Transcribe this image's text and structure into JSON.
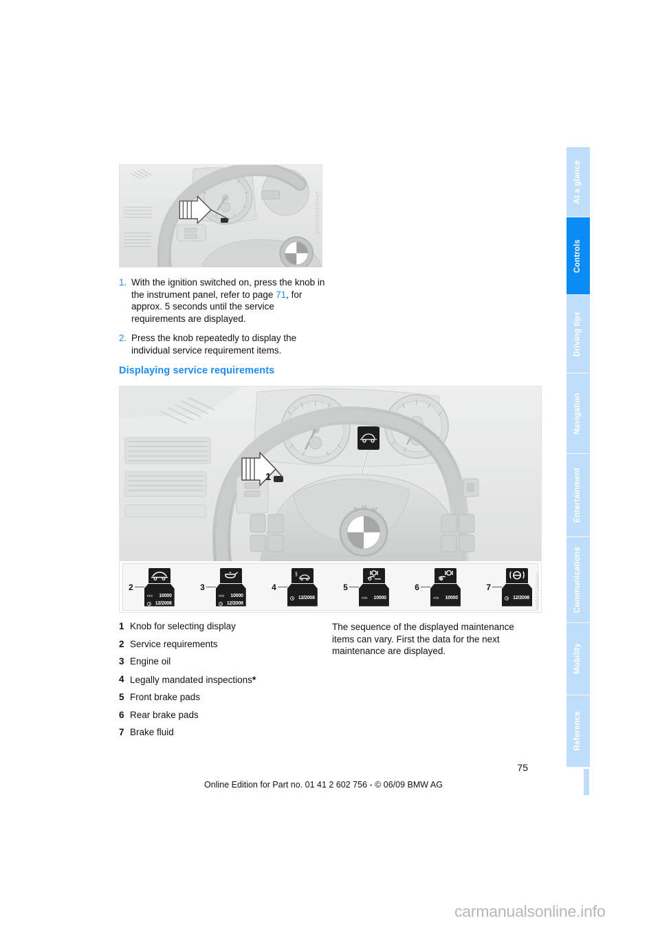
{
  "document": {
    "page_number": "75",
    "footer": "Online Edition for Part no. 01 41 2 602 756 - © 06/09 BMW AG",
    "watermark": "carmanualsonline.info"
  },
  "sidebar": {
    "active": "Controls",
    "tabs": [
      {
        "label": "At a glance",
        "active": false
      },
      {
        "label": "Controls",
        "active": true
      },
      {
        "label": "Driving tips",
        "active": false
      },
      {
        "label": "Navigation",
        "active": false
      },
      {
        "label": "Entertainment",
        "active": false
      },
      {
        "label": "Communications",
        "active": false
      },
      {
        "label": "Mobility",
        "active": false
      },
      {
        "label": "Reference",
        "active": false
      }
    ]
  },
  "figures": {
    "top": {
      "alt": "Instrument panel with steering wheel, arrow pointing to knob",
      "code": "VVG0704500A45"
    },
    "main": {
      "alt": "Steering wheel and instrument cluster with service requirement displays",
      "code": "VVG0722DJ0A"
    }
  },
  "steps": [
    {
      "num": "1.",
      "parts": [
        {
          "text": "With the ignition switched on, press the knob in the instrument panel, refer to page ",
          "link": false
        },
        {
          "text": "71",
          "link": true
        },
        {
          "text": ", for approx. 5 seconds until the service requirements are displayed.",
          "link": false
        }
      ]
    },
    {
      "num": "2.",
      "parts": [
        {
          "text": "Press the knob repeatedly to display the individual service requirement items.",
          "link": false
        }
      ]
    }
  ],
  "heading": "Displaying service requirements",
  "legend": [
    {
      "num": "1",
      "label": "Knob for selecting display",
      "asterisk": false
    },
    {
      "num": "2",
      "label": "Service requirements",
      "asterisk": false
    },
    {
      "num": "3",
      "label": "Engine oil",
      "asterisk": false
    },
    {
      "num": "4",
      "label": "Legally mandated inspections",
      "asterisk": true
    },
    {
      "num": "5",
      "label": "Front brake pads",
      "asterisk": false
    },
    {
      "num": "6",
      "label": "Rear brake pads",
      "asterisk": false
    },
    {
      "num": "7",
      "label": "Brake fluid",
      "asterisk": false
    }
  ],
  "note": "The sequence of the displayed maintenance items can vary. First the data for the next maintenance are displayed.",
  "display_icons": [
    {
      "num": "2",
      "icon": "car-hood-service-icon",
      "unit": "mls",
      "distance": "10000",
      "date": "12/2008",
      "show_distance": true,
      "show_date": true
    },
    {
      "num": "3",
      "icon": "oil-can-icon",
      "unit": "mls",
      "distance": "10000",
      "date": "12/2008",
      "show_distance": true,
      "show_date": true
    },
    {
      "num": "4",
      "icon": "legal-inspection-car-icon",
      "unit": "",
      "distance": "",
      "date": "12/2008",
      "show_distance": false,
      "show_date": true
    },
    {
      "num": "5",
      "icon": "front-brake-pad-icon",
      "unit": "mls",
      "distance": "10000",
      "date": "",
      "show_distance": true,
      "show_date": false
    },
    {
      "num": "6",
      "icon": "rear-brake-pad-icon",
      "unit": "mls",
      "distance": "10000",
      "date": "",
      "show_distance": true,
      "show_date": false
    },
    {
      "num": "7",
      "icon": "brake-fluid-icon",
      "unit": "",
      "distance": "",
      "date": "12/2008",
      "show_distance": false,
      "show_date": true
    }
  ],
  "colors": {
    "accent_blue": "#1a8cf5",
    "tab_active": "#0a8bf5",
    "tab_inactive": "#bedef9",
    "text": "#111111"
  }
}
